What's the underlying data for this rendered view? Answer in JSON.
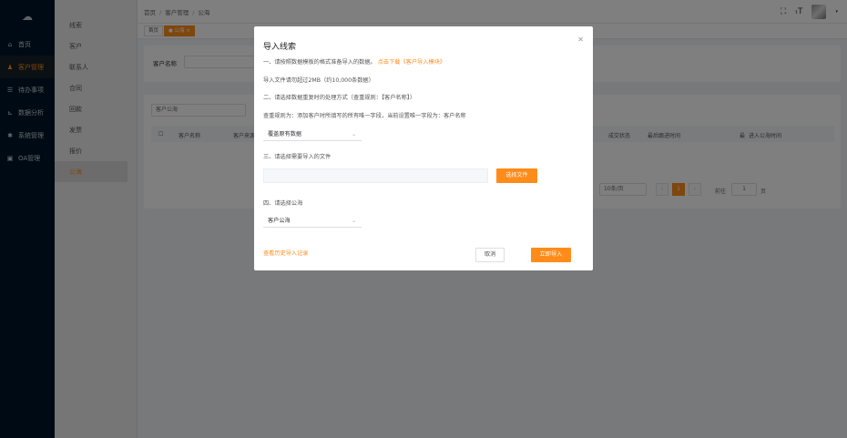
{
  "nav": {
    "items": [
      {
        "label": "首页",
        "icon": "home-icon",
        "glyph": "⌂"
      },
      {
        "label": "客户管理",
        "icon": "customer-icon",
        "glyph": "♟"
      },
      {
        "label": "待办事项",
        "icon": "todo-icon",
        "glyph": "☰"
      },
      {
        "label": "数据分析",
        "icon": "chart-icon",
        "glyph": "⊾"
      },
      {
        "label": "系统管理",
        "icon": "gear-icon",
        "glyph": "✱"
      },
      {
        "label": "OA管理",
        "icon": "oa-icon",
        "glyph": "▣"
      }
    ]
  },
  "sub_nav": {
    "items": [
      "线索",
      "客户",
      "联系人",
      "合同",
      "回款",
      "发票",
      "报价",
      "公海"
    ]
  },
  "header": {
    "breadcrumb": [
      "首页",
      "客户管理",
      "公海"
    ]
  },
  "tags": {
    "items": [
      "首页",
      "● 公海 ×"
    ]
  },
  "page": {
    "filter_label": "客户名称",
    "pool_select": "客户公海",
    "columns": [
      "客户名称",
      "客户来源",
      "成交状态",
      "最后跟进时间",
      "最",
      "进入公海时间"
    ],
    "page_size": "10条/页",
    "current_page": "1",
    "goto_label": "前往",
    "goto_value": "1",
    "page_unit": "页"
  },
  "dialog": {
    "title": "导入线索",
    "step1": "一、请按照数据模板的格式准备导入的数据。",
    "download_link": "点击下载《客户导入模块》",
    "size_note": "导入文件请勿超过2MB（约10,000条数据）",
    "step2": "二、请选择数据重复时的处理方式（查重规则：【客户名称】）",
    "rule_note": "查重规则为：添加客户时所填写的所有唯一字段，当前设置唯一字段为：客户名称",
    "dup_select": "覆盖原有数据",
    "step3": "三、请选择需要导入的文件",
    "file_button": "选择文件",
    "step4": "四、请选择公海",
    "pool_select": "客户公海",
    "history_link": "查看历史导入记录",
    "cancel": "取消",
    "confirm": "立即导入"
  },
  "colors": {
    "accent": "#ff8c1a",
    "nav_bg": "#001529"
  }
}
